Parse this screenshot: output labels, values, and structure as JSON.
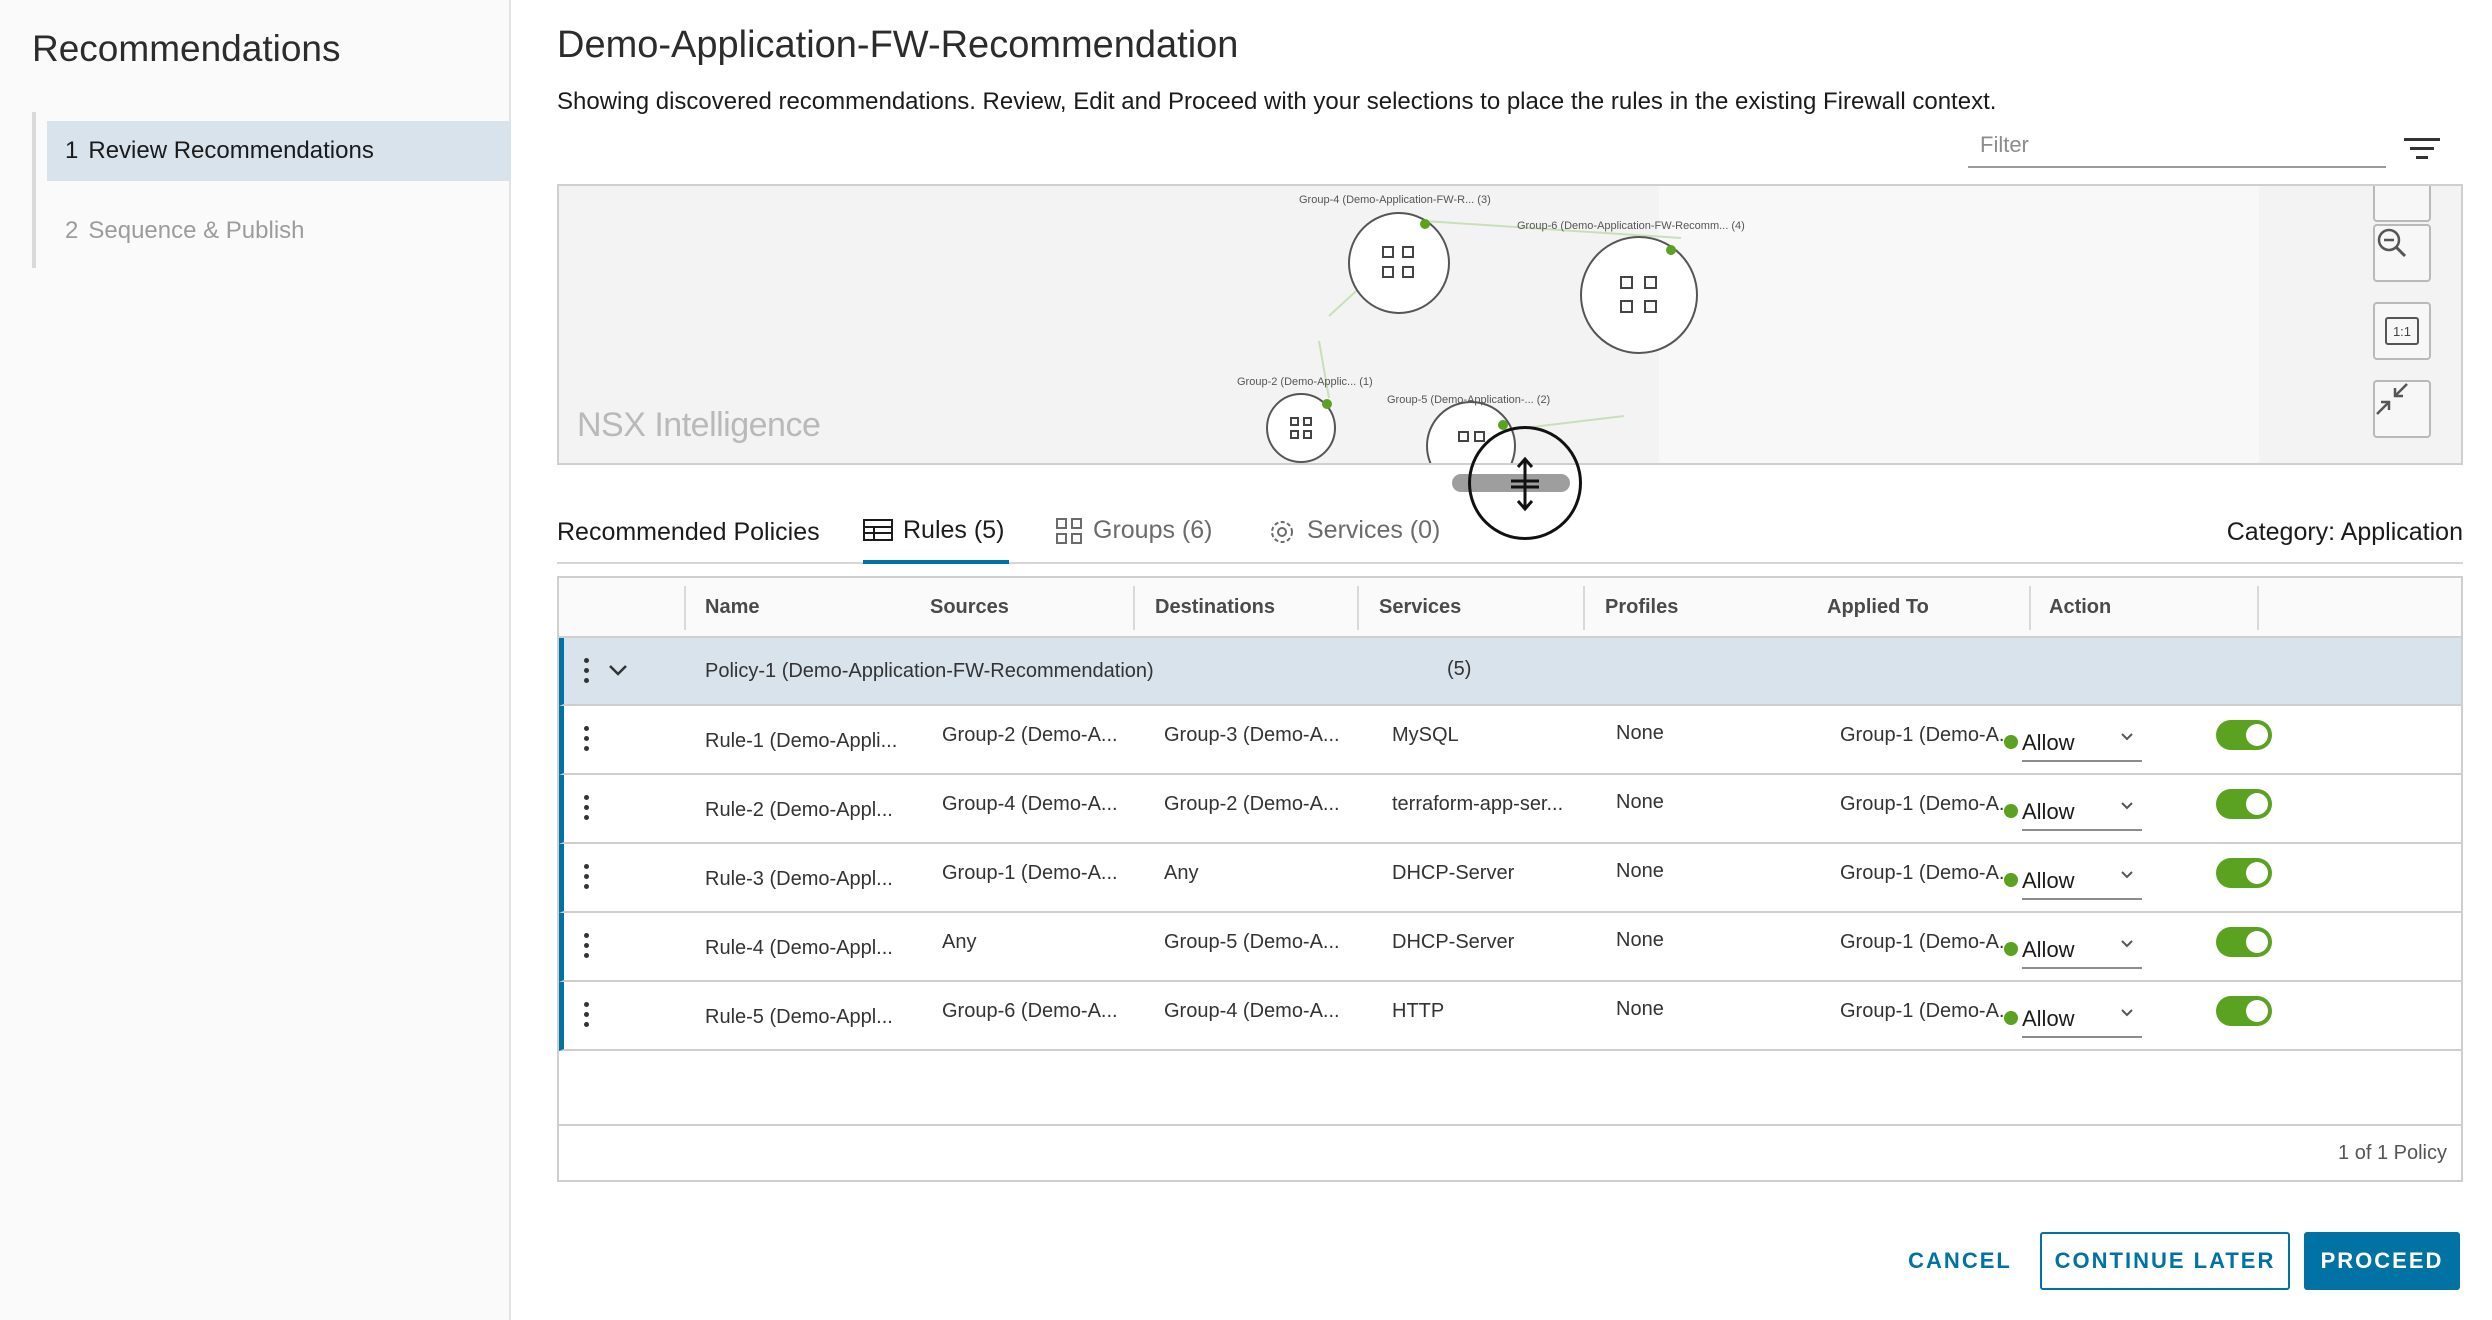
{
  "sidebar": {
    "title": "Recommendations",
    "steps": [
      {
        "num": "1",
        "label": "Review Recommendations",
        "active": true
      },
      {
        "num": "2",
        "label": "Sequence & Publish",
        "active": false
      }
    ]
  },
  "main": {
    "title": "Demo-Application-FW-Recommendation",
    "subtitle": "Showing discovered recommendations. Review, Edit and Proceed with your selections to place the rules in the existing Firewall context.",
    "filter_placeholder": "Filter"
  },
  "graph": {
    "watermark": "NSX Intelligence",
    "nodes": [
      {
        "label": "Group-4 (Demo-Application-FW-R... (3)"
      },
      {
        "label": "Group-6 (Demo-Application-FW-Recomm... (4)"
      },
      {
        "label": "Group-2 (Demo-Applic... (1)"
      },
      {
        "label": "Group-5 (Demo-Application-... (2)"
      }
    ],
    "controls": {
      "zoom_out": "zoom-out",
      "reset": "1:1",
      "collapse": "collapse"
    }
  },
  "tabs": {
    "section_label": "Recommended Policies",
    "items": [
      {
        "label": "Rules (5)",
        "icon": "table-icon",
        "active": true
      },
      {
        "label": "Groups (6)",
        "icon": "groups-icon",
        "active": false
      },
      {
        "label": "Services (0)",
        "icon": "gear-icon",
        "active": false
      }
    ],
    "category": "Category: Application"
  },
  "grid": {
    "columns": [
      "Name",
      "Sources",
      "Destinations",
      "Services",
      "Profiles",
      "Applied To",
      "Action"
    ],
    "policy": {
      "name": "Policy-1 (Demo-Application-FW-Recommendation)",
      "count": "(5)"
    },
    "rows": [
      {
        "name": "Rule-1 (Demo-Appli...",
        "sources": "Group-2 (Demo-A...",
        "destinations": "Group-3 (Demo-A...",
        "services": "MySQL",
        "profiles": "None",
        "applied_to": "Group-1 (Demo-A...",
        "action": "Allow"
      },
      {
        "name": "Rule-2 (Demo-Appl...",
        "sources": "Group-4 (Demo-A...",
        "destinations": "Group-2 (Demo-A...",
        "services": "terraform-app-ser...",
        "profiles": "None",
        "applied_to": "Group-1 (Demo-A...",
        "action": "Allow"
      },
      {
        "name": "Rule-3 (Demo-Appl...",
        "sources": "Group-1 (Demo-A...",
        "destinations": "Any",
        "services": "DHCP-Server",
        "profiles": "None",
        "applied_to": "Group-1 (Demo-A...",
        "action": "Allow"
      },
      {
        "name": "Rule-4 (Demo-Appl...",
        "sources": "Any",
        "destinations": "Group-5 (Demo-A...",
        "services": "DHCP-Server",
        "profiles": "None",
        "applied_to": "Group-1 (Demo-A...",
        "action": "Allow"
      },
      {
        "name": "Rule-5 (Demo-Appl...",
        "sources": "Group-6 (Demo-A...",
        "destinations": "Group-4 (Demo-A...",
        "services": "HTTP",
        "profiles": "None",
        "applied_to": "Group-1 (Demo-A...",
        "action": "Allow"
      }
    ],
    "footer": "1 of 1 Policy"
  },
  "buttons": {
    "cancel": "CANCEL",
    "continue_later": "CONTINUE LATER",
    "proceed": "PROCEED"
  },
  "colors": {
    "accent": "#0072a3",
    "selected_bg": "#d8e3ec",
    "allow_green": "#5aa220"
  }
}
